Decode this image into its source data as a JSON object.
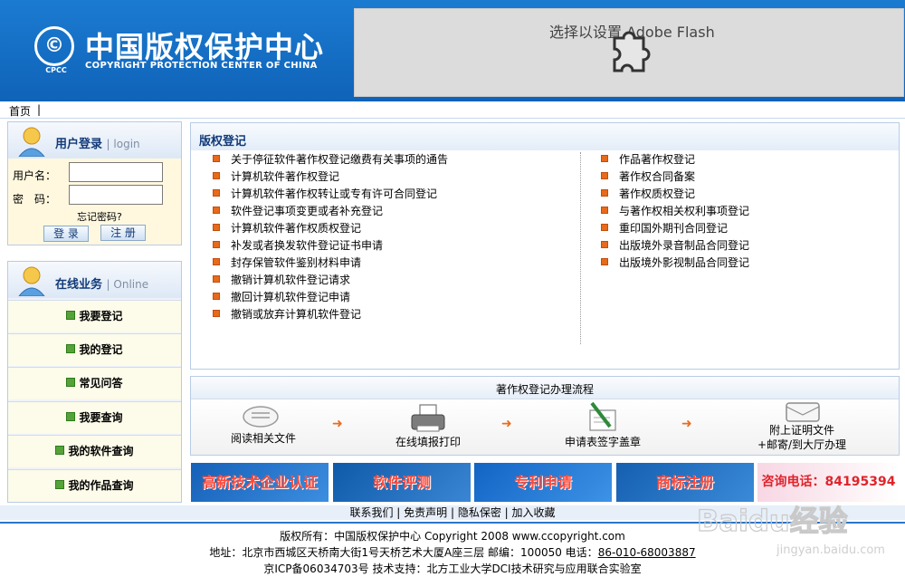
{
  "header": {
    "logo_seal": "©",
    "logo_seal_sub": "CPCC",
    "logo_cn": "中国版权保护中心",
    "logo_en": "COPYRIGHT PROTECTION CENTER OF CHINA",
    "flash_text": "选择以设置 Adobe Flash"
  },
  "nav": {
    "home": "首页",
    "sep": "|"
  },
  "login": {
    "title": "用户登录",
    "title_sub": "login",
    "username_label": "用户名：",
    "password_label": "密　码：",
    "forgot": "忘记密码?",
    "login_btn": "登 录",
    "register_btn": "注 册"
  },
  "online": {
    "title": "在线业务",
    "title_sub": "Online",
    "items": [
      "我要登记",
      "我的登记",
      "常见问答",
      "我要查询",
      "我的软件查询",
      "我的作品查询"
    ]
  },
  "main": {
    "title": "版权登记",
    "left_links": [
      "关于停征软件著作权登记缴费有关事项的通告",
      "计算机软件著作权登记",
      "计算机软件著作权转让或专有许可合同登记",
      "软件登记事项变更或者补充登记",
      "计算机软件著作权质权登记",
      "补发或者换发软件登记证书申请",
      "封存保管软件鉴别材料申请",
      "撤销计算机软件登记请求",
      "撤回计算机软件登记申请",
      "撤销或放弃计算机软件登记"
    ],
    "right_links": [
      "作品著作权登记",
      "著作权合同备案",
      "著作权质权登记",
      "与著作权相关权利事项登记",
      "重印国外期刊合同登记",
      "出版境外录音制品合同登记",
      "出版境外影视制品合同登记"
    ]
  },
  "flow": {
    "title": "著作权登记办理流程",
    "steps": [
      "阅读相关文件",
      "在线填报打印",
      "申请表签字盖章",
      "附上证明文件",
      "+邮寄/到大厅办理"
    ],
    "arrow": "➜"
  },
  "banners": [
    "高新技术企业认证",
    "软件评测",
    "专利申请",
    "商标注册",
    "咨询电话：84195394"
  ],
  "footer": {
    "links": "联系我们 | 免责声明 | 隐私保密 | 加入收藏",
    "copyright": "版权所有：中国版权保护中心 Copyright 2008 www.ccopyright.com",
    "address_prefix": "地址：北京市西城区天桥南大街1号天桥艺术大厦A座三层 邮编：100050 电话：",
    "phone": "86-010-68003887",
    "icp": "京ICP备06034703号 技术支持：北方工业大学DCI技术研究与应用联合实验室"
  },
  "watermark": {
    "brand": "Baidu经验",
    "url": "jingyan.baidu.com"
  },
  "colors": {
    "header_blue": "#0f63b8",
    "title_navy": "#123a78",
    "bullet_orange": "#e86a1a",
    "banner_blue": "#1a5fb4",
    "banner_red": "#e03a2c"
  }
}
